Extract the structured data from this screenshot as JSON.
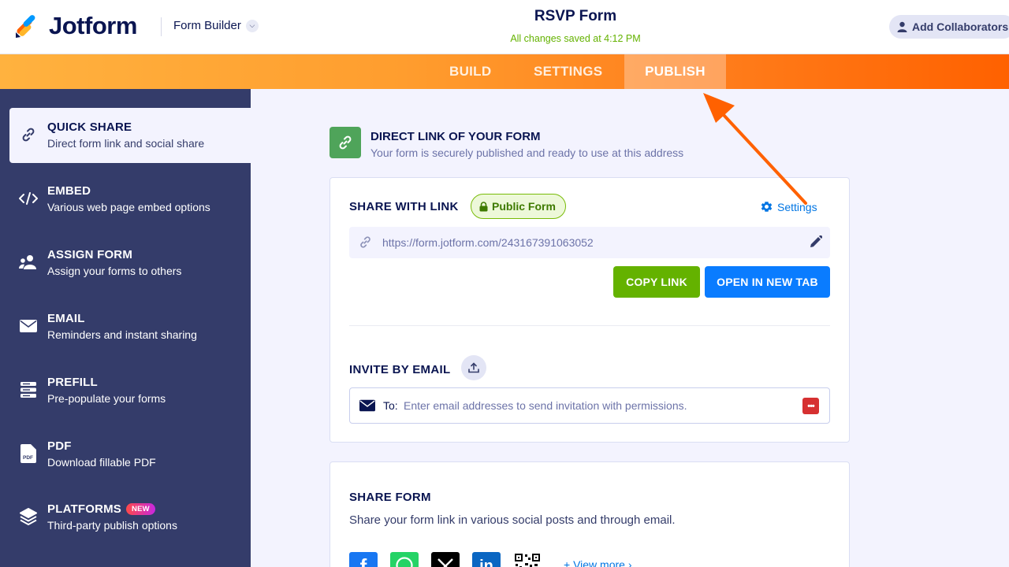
{
  "header": {
    "logo_text": "Jotform",
    "mode_label": "Form Builder",
    "form_title": "RSVP Form",
    "save_status": "All changes saved at 4:12 PM",
    "collaborators_label": "Add Collaborators"
  },
  "nav": {
    "tabs": [
      {
        "label": "BUILD",
        "active": false
      },
      {
        "label": "SETTINGS",
        "active": false
      },
      {
        "label": "PUBLISH",
        "active": true
      }
    ]
  },
  "sidebar": {
    "items": [
      {
        "title": "QUICK SHARE",
        "subtitle": "Direct form link and social share",
        "icon": "link-icon",
        "active": true
      },
      {
        "title": "EMBED",
        "subtitle": "Various web page embed options",
        "icon": "code-icon"
      },
      {
        "title": "ASSIGN FORM",
        "subtitle": "Assign your forms to others",
        "icon": "users-icon"
      },
      {
        "title": "EMAIL",
        "subtitle": "Reminders and instant sharing",
        "icon": "envelope-icon"
      },
      {
        "title": "PREFILL",
        "subtitle": "Pre-populate your forms",
        "icon": "prefill-icon"
      },
      {
        "title": "PDF",
        "subtitle": "Download fillable PDF",
        "icon": "pdf-icon"
      },
      {
        "title": "PLATFORMS",
        "subtitle": "Third-party publish options",
        "icon": "layers-icon",
        "badge": "NEW"
      }
    ]
  },
  "main": {
    "direct_link": {
      "title": "DIRECT LINK OF YOUR FORM",
      "subtitle": "Your form is securely published and ready to use at this address"
    },
    "share_with_link": {
      "title": "SHARE WITH LINK",
      "badge": "Public Form",
      "settings_label": "Settings",
      "url": "https://form.jotform.com/243167391063052",
      "copy_label": "COPY LINK",
      "open_label": "OPEN IN NEW TAB"
    },
    "invite": {
      "title": "INVITE BY EMAIL",
      "to_label": "To:",
      "placeholder": "Enter email addresses to send invitation with permissions."
    },
    "share_form": {
      "title": "SHARE FORM",
      "subtitle": "Share your form link in various social posts and through email.",
      "view_more": "+ View more ›",
      "social": [
        "facebook-icon",
        "whatsapp-icon",
        "x-icon",
        "linkedin-icon",
        "qr-code-icon"
      ]
    }
  },
  "colors": {
    "accent_orange": "#ff6100",
    "sidebar_bg": "#343c6a",
    "copy_green": "#64b200",
    "open_blue": "#0a7cff"
  }
}
